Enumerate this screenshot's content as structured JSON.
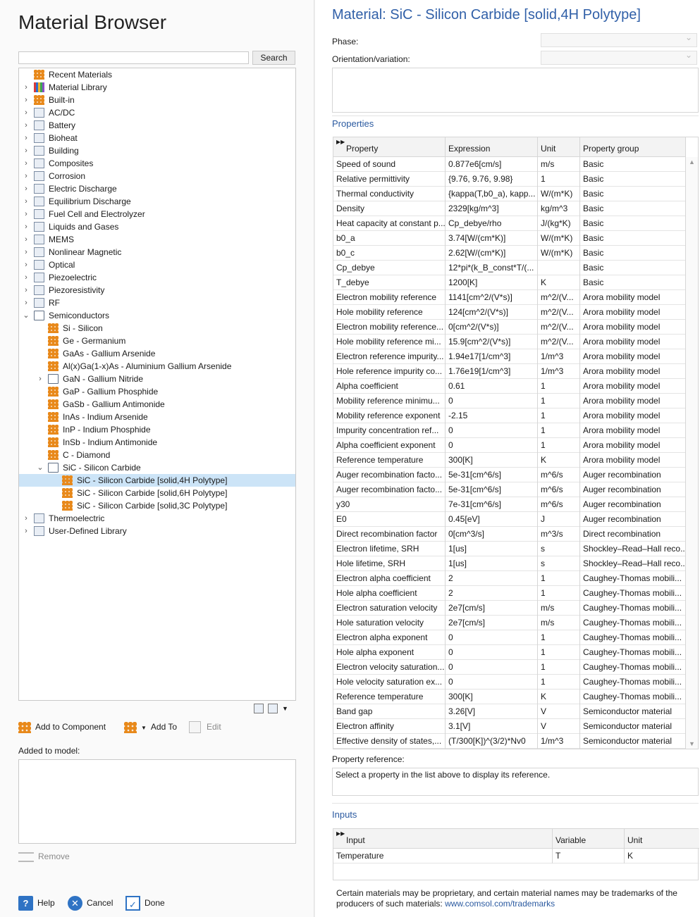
{
  "left": {
    "title": "Material Browser",
    "search": {
      "value": "",
      "button_label": "Search"
    },
    "tree": [
      {
        "label": "Recent Materials",
        "level": 0,
        "expander": "",
        "icon": "mat-icon"
      },
      {
        "label": "Material Library",
        "level": 0,
        "expander": "›",
        "icon": "lib-icon"
      },
      {
        "label": "Built-in",
        "level": 0,
        "expander": "›",
        "icon": "mat-icon"
      },
      {
        "label": "AC/DC",
        "level": 0,
        "expander": "›",
        "icon": "acdc-icon"
      },
      {
        "label": "Battery",
        "level": 0,
        "expander": "›",
        "icon": "battery-icon"
      },
      {
        "label": "Bioheat",
        "level": 0,
        "expander": "›",
        "icon": "bioheat-icon"
      },
      {
        "label": "Building",
        "level": 0,
        "expander": "›",
        "icon": "building-icon"
      },
      {
        "label": "Composites",
        "level": 0,
        "expander": "›",
        "icon": "composites-icon"
      },
      {
        "label": "Corrosion",
        "level": 0,
        "expander": "›",
        "icon": "corrosion-icon"
      },
      {
        "label": "Electric Discharge",
        "level": 0,
        "expander": "›",
        "icon": "discharge-icon"
      },
      {
        "label": "Equilibrium Discharge",
        "level": 0,
        "expander": "›",
        "icon": "equilibrium-icon"
      },
      {
        "label": "Fuel Cell and Electrolyzer",
        "level": 0,
        "expander": "›",
        "icon": "fuelcell-icon"
      },
      {
        "label": "Liquids and Gases",
        "level": 0,
        "expander": "›",
        "icon": "liquids-icon"
      },
      {
        "label": "MEMS",
        "level": 0,
        "expander": "›",
        "icon": "mems-icon"
      },
      {
        "label": "Nonlinear Magnetic",
        "level": 0,
        "expander": "›",
        "icon": "magnet-icon"
      },
      {
        "label": "Optical",
        "level": 0,
        "expander": "›",
        "icon": "optical-icon"
      },
      {
        "label": "Piezoelectric",
        "level": 0,
        "expander": "›",
        "icon": "piezo-icon"
      },
      {
        "label": "Piezoresistivity",
        "level": 0,
        "expander": "›",
        "icon": "piezoresist-icon"
      },
      {
        "label": "RF",
        "level": 0,
        "expander": "›",
        "icon": "rf-icon"
      },
      {
        "label": "Semiconductors",
        "level": 0,
        "expander": "⌄",
        "icon": "chip-icon"
      },
      {
        "label": "Si - Silicon",
        "level": 1,
        "expander": "",
        "icon": "mat-icon"
      },
      {
        "label": "Ge - Germanium",
        "level": 1,
        "expander": "",
        "icon": "mat-icon"
      },
      {
        "label": "GaAs - Gallium Arsenide",
        "level": 1,
        "expander": "",
        "icon": "mat-icon"
      },
      {
        "label": "Al(x)Ga(1-x)As - Aluminium Gallium Arsenide",
        "level": 1,
        "expander": "",
        "icon": "mat-icon"
      },
      {
        "label": "GaN - Gallium Nitride",
        "level": 1,
        "expander": "›",
        "icon": "chip-icon"
      },
      {
        "label": "GaP - Gallium Phosphide",
        "level": 1,
        "expander": "",
        "icon": "mat-icon"
      },
      {
        "label": "GaSb - Gallium Antimonide",
        "level": 1,
        "expander": "",
        "icon": "mat-icon"
      },
      {
        "label": "InAs - Indium Arsenide",
        "level": 1,
        "expander": "",
        "icon": "mat-icon"
      },
      {
        "label": "InP - Indium Phosphide",
        "level": 1,
        "expander": "",
        "icon": "mat-icon"
      },
      {
        "label": "InSb - Indium Antimonide",
        "level": 1,
        "expander": "",
        "icon": "mat-icon"
      },
      {
        "label": "C - Diamond",
        "level": 1,
        "expander": "",
        "icon": "mat-icon"
      },
      {
        "label": "SiC - Silicon Carbide",
        "level": 1,
        "expander": "⌄",
        "icon": "chip-icon"
      },
      {
        "label": "SiC - Silicon Carbide [solid,4H Polytype]",
        "level": 2,
        "expander": "",
        "icon": "mat-icon",
        "selected": true
      },
      {
        "label": "SiC - Silicon Carbide  [solid,6H Polytype]",
        "level": 2,
        "expander": "",
        "icon": "mat-icon"
      },
      {
        "label": "SiC - Silicon Carbide [solid,3C Polytype]",
        "level": 2,
        "expander": "",
        "icon": "mat-icon"
      },
      {
        "label": "Thermoelectric",
        "level": 0,
        "expander": "›",
        "icon": "thermo-icon"
      },
      {
        "label": "User-Defined Library",
        "level": 0,
        "expander": "›",
        "icon": "userlib-icon"
      }
    ],
    "actions": {
      "add_to_component": "Add to Component",
      "add_to": "Add To",
      "edit": "Edit"
    },
    "added_label": "Added to model:",
    "remove": "Remove",
    "footer": {
      "help": "Help",
      "cancel": "Cancel",
      "done": "Done"
    }
  },
  "right": {
    "title": "Material: SiC - Silicon Carbide [solid,4H Polytype]",
    "phase_label": "Phase:",
    "orientation_label": "Orientation/variation:",
    "properties_title": "Properties",
    "columns": [
      "Property",
      "Expression",
      "Unit",
      "Property group"
    ],
    "rows": [
      [
        "Speed of sound",
        "0.877e6[cm/s]",
        "m/s",
        "Basic"
      ],
      [
        "Relative permittivity",
        "{9.76, 9.76, 9.98}",
        "1",
        "Basic"
      ],
      [
        "Thermal conductivity",
        "{kappa(T,b0_a), kapp...",
        "W/(m*K)",
        "Basic"
      ],
      [
        "Density",
        "2329[kg/m^3]",
        "kg/m^3",
        "Basic"
      ],
      [
        "Heat capacity at constant p...",
        "Cp_debye/rho",
        "J/(kg*K)",
        "Basic"
      ],
      [
        "b0_a",
        "3.74[W/(cm*K)]",
        "W/(m*K)",
        "Basic"
      ],
      [
        "b0_c",
        "2.62[W/(cm*K)]",
        "W/(m*K)",
        "Basic"
      ],
      [
        "Cp_debye",
        "12*pi*(k_B_const*T/(...",
        "",
        "Basic"
      ],
      [
        "T_debye",
        "1200[K]",
        "K",
        "Basic"
      ],
      [
        "Electron mobility reference",
        "1141[cm^2/(V*s)]",
        "m^2/(V...",
        "Arora mobility model"
      ],
      [
        "Hole mobility reference",
        "124[cm^2/(V*s)]",
        "m^2/(V...",
        "Arora mobility model"
      ],
      [
        "Electron mobility reference...",
        "0[cm^2/(V*s)]",
        "m^2/(V...",
        "Arora mobility model"
      ],
      [
        "Hole mobility reference mi...",
        "15.9[cm^2/(V*s)]",
        "m^2/(V...",
        "Arora mobility model"
      ],
      [
        "Electron reference impurity...",
        "1.94e17[1/cm^3]",
        "1/m^3",
        "Arora mobility model"
      ],
      [
        "Hole reference impurity co...",
        "1.76e19[1/cm^3]",
        "1/m^3",
        "Arora mobility model"
      ],
      [
        "Alpha coefficient",
        "0.61",
        "1",
        "Arora mobility model"
      ],
      [
        "Mobility reference minimu...",
        "0",
        "1",
        "Arora mobility model"
      ],
      [
        "Mobility reference exponent",
        "-2.15",
        "1",
        "Arora mobility model"
      ],
      [
        "Impurity concentration ref...",
        "0",
        "1",
        "Arora mobility model"
      ],
      [
        "Alpha coefficient exponent",
        "0",
        "1",
        "Arora mobility model"
      ],
      [
        "Reference temperature",
        "300[K]",
        "K",
        "Arora mobility model"
      ],
      [
        "Auger recombination facto...",
        "5e-31[cm^6/s]",
        "m^6/s",
        "Auger recombination"
      ],
      [
        "Auger recombination facto...",
        "5e-31[cm^6/s]",
        "m^6/s",
        "Auger recombination"
      ],
      [
        "y30",
        "7e-31[cm^6/s]",
        "m^6/s",
        "Auger recombination"
      ],
      [
        "E0",
        "0.45[eV]",
        "J",
        "Auger recombination"
      ],
      [
        "Direct recombination factor",
        "0[cm^3/s]",
        "m^3/s",
        "Direct recombination"
      ],
      [
        "Electron lifetime, SRH",
        "1[us]",
        "s",
        "Shockley–Read–Hall reco..."
      ],
      [
        "Hole lifetime, SRH",
        "1[us]",
        "s",
        "Shockley–Read–Hall reco..."
      ],
      [
        "Electron alpha coefficient",
        "2",
        "1",
        "Caughey-Thomas mobili..."
      ],
      [
        "Hole alpha coefficient",
        "2",
        "1",
        "Caughey-Thomas mobili..."
      ],
      [
        "Electron saturation velocity",
        "2e7[cm/s]",
        "m/s",
        "Caughey-Thomas mobili..."
      ],
      [
        "Hole saturation velocity",
        "2e7[cm/s]",
        "m/s",
        "Caughey-Thomas mobili..."
      ],
      [
        "Electron alpha exponent",
        "0",
        "1",
        "Caughey-Thomas mobili..."
      ],
      [
        "Hole alpha exponent",
        "0",
        "1",
        "Caughey-Thomas mobili..."
      ],
      [
        "Electron velocity saturation...",
        "0",
        "1",
        "Caughey-Thomas mobili..."
      ],
      [
        "Hole velocity saturation ex...",
        "0",
        "1",
        "Caughey-Thomas mobili..."
      ],
      [
        "Reference temperature",
        "300[K]",
        "K",
        "Caughey-Thomas mobili..."
      ],
      [
        "Band gap",
        "3.26[V]",
        "V",
        "Semiconductor material"
      ],
      [
        "Electron affinity",
        "3.1[V]",
        "V",
        "Semiconductor material"
      ],
      [
        "Effective density of states,...",
        "(T/300[K])^(3/2)*Nv0",
        "1/m^3",
        "Semiconductor material"
      ]
    ],
    "reference_label": "Property reference:",
    "reference_text": "Select a property in the list above to display its reference.",
    "inputs_title": "Inputs",
    "inputs_columns": [
      "Input",
      "Variable",
      "Unit"
    ],
    "inputs_rows": [
      [
        "Temperature",
        "T",
        "K"
      ]
    ],
    "disclaimer": "Certain materials may be proprietary, and certain material names may be trademarks of the producers of such materials: ",
    "disclaimer_link": "www.comsol.com/trademarks"
  }
}
